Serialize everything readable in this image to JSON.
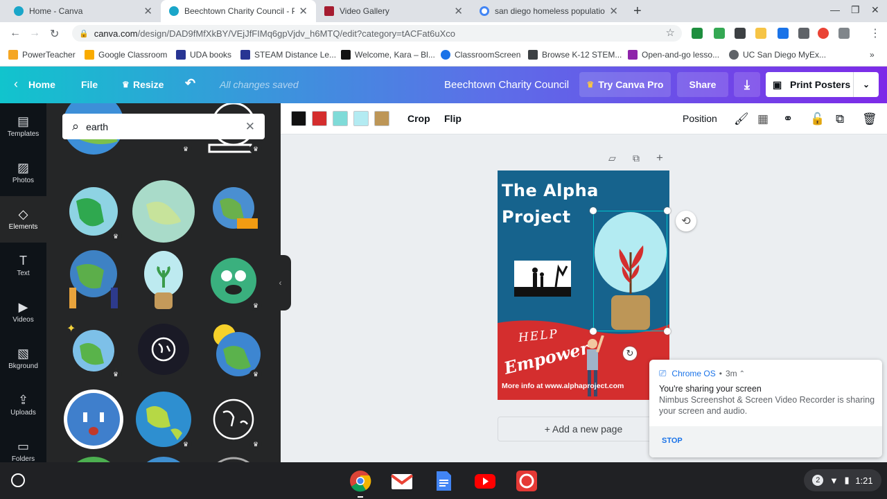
{
  "browser": {
    "tabs": [
      {
        "title": "Home - Canva",
        "active": false
      },
      {
        "title": "Beechtown Charity Council - Pos",
        "active": true
      },
      {
        "title": "Video Gallery",
        "active": false
      },
      {
        "title": "san diego homeless population",
        "active": false
      }
    ],
    "new_tab": "+",
    "url_host": "canva.com",
    "url_path": "/design/DAD9fMfXkBY/VEjJfFIMq6gpVjdv_h6MTQ/edit?category=tACFat6uXco",
    "bookmarks": [
      "PowerTeacher",
      "Google Classroom",
      "UDA books",
      "STEAM Distance Le...",
      "Welcome, Kara – Bl...",
      "ClassroomScreen",
      "Browse K-12 STEM...",
      "Open-and-go lesso...",
      "UC San Diego MyEx..."
    ],
    "bookmarks_more": "»"
  },
  "header": {
    "home": "Home",
    "file": "File",
    "resize": "Resize",
    "saved_status": "All changes saved",
    "doc_title": "Beechtown Charity Council",
    "try_pro": "Try Canva Pro",
    "share": "Share",
    "print": "Print Posters"
  },
  "sidebar": {
    "items": [
      {
        "label": "Templates",
        "icon": "templates-icon"
      },
      {
        "label": "Photos",
        "icon": "photos-icon"
      },
      {
        "label": "Elements",
        "icon": "elements-icon"
      },
      {
        "label": "Text",
        "icon": "text-icon"
      },
      {
        "label": "Videos",
        "icon": "videos-icon"
      },
      {
        "label": "Bkground",
        "icon": "background-icon"
      },
      {
        "label": "Uploads",
        "icon": "uploads-icon"
      },
      {
        "label": "Folders",
        "icon": "folders-icon"
      }
    ]
  },
  "panel": {
    "search_value": "earth"
  },
  "toolbar": {
    "colors": [
      "#111111",
      "#d42e2e",
      "#7fdbd8",
      "#b3ebf2",
      "#bd9657"
    ],
    "crop": "Crop",
    "flip": "Flip",
    "position": "Position"
  },
  "poster": {
    "title_line1": "The Alpha",
    "title_line2": "Project",
    "help": "HELP",
    "empower": "Empower",
    "info": "More info at www.alphaproject.com",
    "bg_color": "#16638d",
    "banner_color": "#d42e2e"
  },
  "canvas": {
    "add_page": "+ Add a new page"
  },
  "notification": {
    "app": "Chrome OS",
    "age": "3m",
    "title": "You're sharing your screen",
    "body": "Nimbus Screenshot & Screen Video Recorder is sharing your screen and audio.",
    "action": "STOP"
  },
  "shelf": {
    "badge": "2",
    "time": "1:21"
  }
}
